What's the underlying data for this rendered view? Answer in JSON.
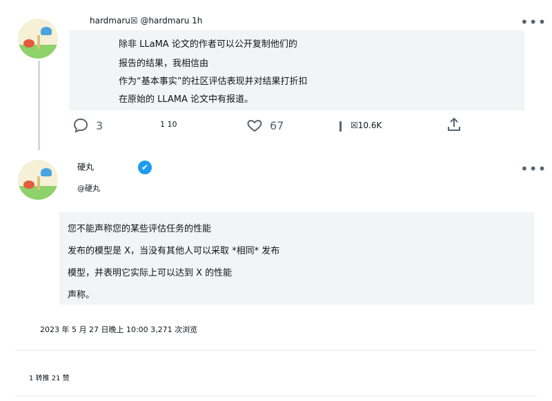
{
  "tweet1": {
    "header": "hardmaru☒ @hardmaru 1h",
    "lines": [
      "除非 LLaMA 论文的作者可以公开复制他们的",
      "报告的结果，我相信由",
      "作为“基本事实”的社区评估表现并对结果打折扣",
      "在原始的 LLAMA 论文中有报道。"
    ],
    "actions": {
      "replies": "3",
      "retweets": "1 10",
      "likes": "67",
      "views": "☒10.6K"
    },
    "more": "•••"
  },
  "tweet2": {
    "name": "硬丸",
    "handle": "@硬丸",
    "verified_mark": "✔",
    "lines": [
      "您不能声称您的某些评估任务的性能",
      "发布的模型是 X，当没有其他人可以采取 *相同* 发布",
      "模型，并表明它实际上可以达到 X 的性能",
      "声称。"
    ],
    "timestamp": "2023 年 5 月 27 日晚上 10:00 3,271 次浏览",
    "stats": "1 转推 21 赞",
    "more": "•••"
  },
  "colors": {
    "accent": "#1d9bf0",
    "text": "#0f1419",
    "muted": "#536471"
  }
}
